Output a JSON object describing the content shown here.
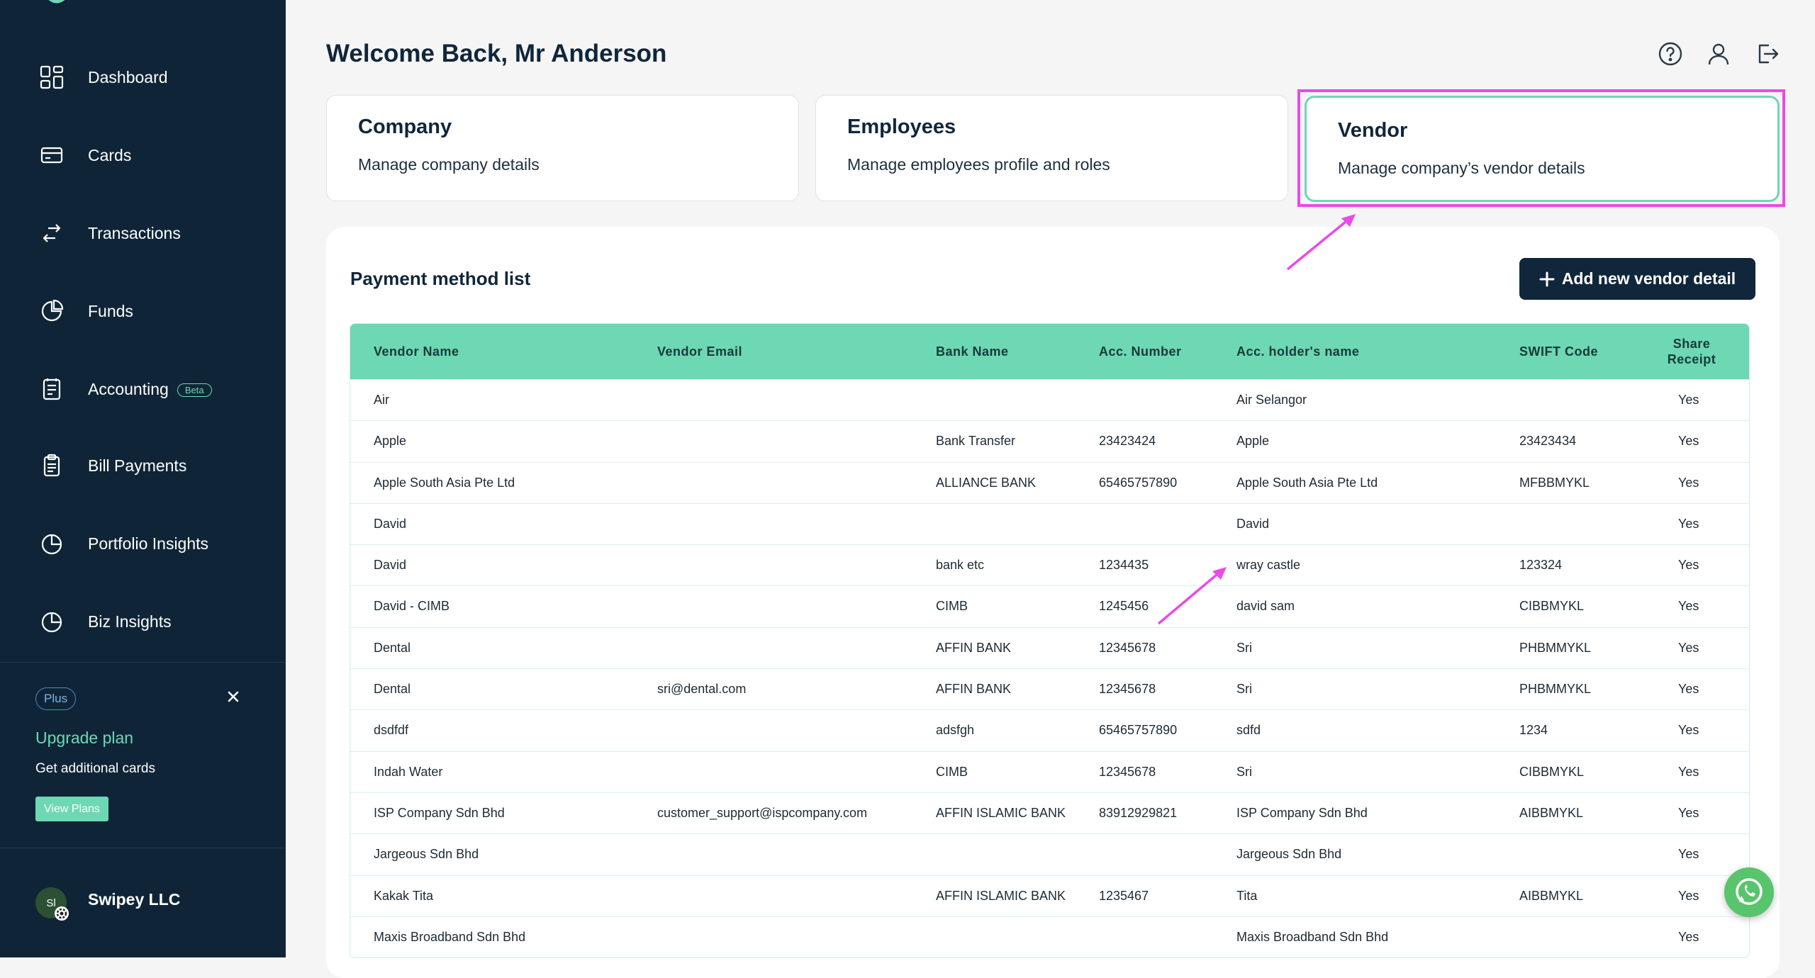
{
  "sidebar": {
    "nav": [
      {
        "label": "Dashboard",
        "icon": "dashboard-grid-icon"
      },
      {
        "label": "Cards",
        "icon": "card-icon"
      },
      {
        "label": "Transactions",
        "icon": "transfer-arrows-icon"
      },
      {
        "label": "Funds",
        "icon": "pie-chart-icon"
      },
      {
        "label": "Accounting",
        "icon": "ledger-icon",
        "badge": "Beta"
      },
      {
        "label": "Bill Payments",
        "icon": "clipboard-icon"
      },
      {
        "label": "Portfolio Insights",
        "icon": "pie-chart-icon"
      },
      {
        "label": "Biz Insights",
        "icon": "pie-chart-icon"
      }
    ],
    "upgrade": {
      "badge": "Plus",
      "title": "Upgrade plan",
      "subtitle": "Get additional cards",
      "button": "View Plans"
    },
    "org": {
      "initials": "Sl",
      "name": "Swipey LLC"
    }
  },
  "header": {
    "welcome": "Welcome Back, Mr Anderson",
    "icons": [
      "help-icon",
      "user-icon",
      "logout-icon"
    ]
  },
  "cards": [
    {
      "title": "Company",
      "subtitle": "Manage company details"
    },
    {
      "title": "Employees",
      "subtitle": "Manage employees profile and roles"
    },
    {
      "title": "Vendor",
      "subtitle": "Manage company’s vendor details"
    }
  ],
  "panel": {
    "title": "Payment method list",
    "add_button": "Add new vendor detail"
  },
  "table": {
    "columns": [
      "Vendor Name",
      "Vendor Email",
      "Bank Name",
      "Acc. Number",
      "Acc. holder's name",
      "SWIFT Code",
      "Share Receipt"
    ],
    "rows": [
      [
        "Air",
        "",
        "",
        "",
        "Air Selangor",
        "",
        "Yes"
      ],
      [
        "Apple",
        "",
        "Bank Transfer",
        "23423424",
        "Apple",
        "23423434",
        "Yes"
      ],
      [
        "Apple South Asia Pte Ltd",
        "",
        "ALLIANCE BANK",
        "65465757890",
        "Apple South Asia Pte Ltd",
        "MFBBMYKL",
        "Yes"
      ],
      [
        "David",
        "",
        "",
        "",
        "David",
        "",
        "Yes"
      ],
      [
        "David",
        "",
        "bank etc",
        "1234435",
        "wray castle",
        "123324",
        "Yes"
      ],
      [
        "David - CIMB",
        "",
        "CIMB",
        "1245456",
        "david sam",
        "CIBBMYKL",
        "Yes"
      ],
      [
        "Dental",
        "",
        "AFFIN BANK",
        "12345678",
        "Sri",
        "PHBMMYKL",
        "Yes"
      ],
      [
        "Dental",
        "sri@dental.com",
        "AFFIN BANK",
        "12345678",
        "Sri",
        "PHBMMYKL",
        "Yes"
      ],
      [
        "dsdfdf",
        "",
        "adsfgh",
        "65465757890",
        "sdfd",
        "1234",
        "Yes"
      ],
      [
        "Indah Water",
        "",
        "CIMB",
        "12345678",
        "Sri",
        "CIBBMYKL",
        "Yes"
      ],
      [
        "ISP Company Sdn Bhd",
        "customer_support@ispcompany.com",
        "AFFIN ISLAMIC BANK",
        "83912929821",
        "ISP Company Sdn Bhd",
        "AIBBMYKL",
        "Yes"
      ],
      [
        "Jargeous Sdn Bhd",
        "",
        "",
        "",
        "Jargeous Sdn Bhd",
        "",
        "Yes"
      ],
      [
        "Kakak Tita",
        "",
        "AFFIN ISLAMIC BANK",
        "1235467",
        "Tita",
        "AIBBMYKL",
        "Yes"
      ],
      [
        "Maxis Broadband Sdn Bhd",
        "",
        "",
        "",
        "Maxis Broadband Sdn Bhd",
        "",
        "Yes"
      ]
    ]
  },
  "colors": {
    "sidebar_bg": "#0f2537",
    "accent": "#6ed7b4",
    "annotation": "#e94ae9",
    "primary_button": "#10263a"
  }
}
